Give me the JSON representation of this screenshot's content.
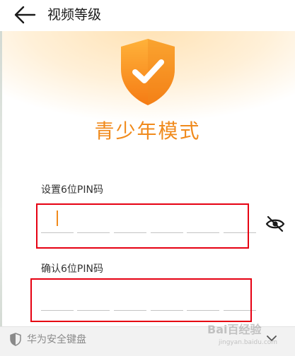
{
  "header": {
    "title": "视频等级",
    "back_icon": "arrow-left-icon"
  },
  "hero": {
    "icon": "shield-check-icon",
    "title": "青少年模式",
    "colors": {
      "accent": "#f08a1c",
      "shield_top": "#ffb23a",
      "shield_bottom": "#f57b14"
    }
  },
  "pin_set": {
    "label": "设置6位PIN码",
    "digits": [
      "",
      "",
      "",
      "",
      "",
      ""
    ],
    "visibility_icon": "eye-off-icon"
  },
  "pin_confirm": {
    "label": "确认6位PIN码",
    "digits": [
      "",
      "",
      "",
      "",
      "",
      ""
    ]
  },
  "keyboard_bar": {
    "icon": "shield-icon",
    "label": "华为安全键盘",
    "collapse_icon": "chevron-down-icon"
  },
  "watermark": {
    "text": "Bai百经验",
    "sub": "jingyan.baidu.com"
  },
  "annotation_color": "#e60012"
}
